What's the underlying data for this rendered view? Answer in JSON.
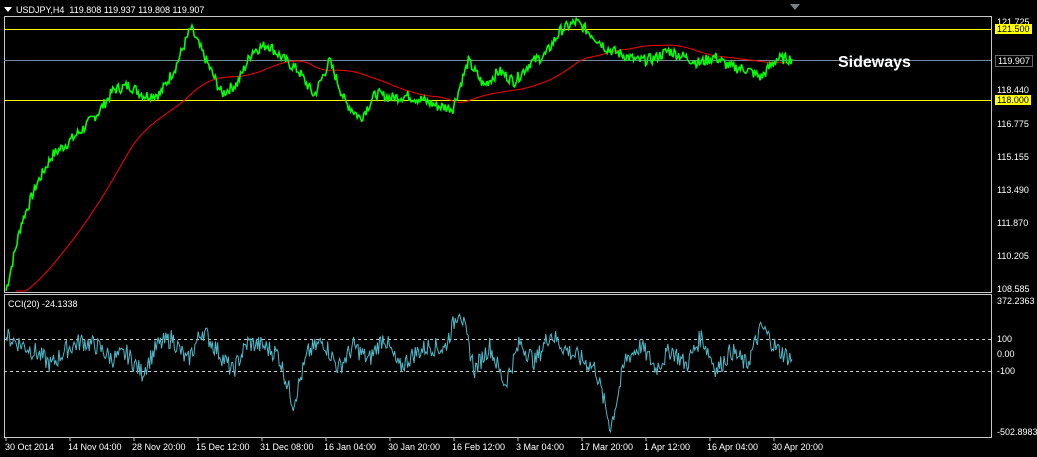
{
  "header": {
    "symbol": "USDJPY,H4",
    "ohlc": "119.808 119.937 119.808 119.907"
  },
  "annotation": "Sideways",
  "price_axis": {
    "labels": [
      "121.500",
      "119.907",
      "118.440",
      "118.000",
      "116.775",
      "115.155",
      "113.490",
      "111.870",
      "110.205",
      "108.585"
    ],
    "resistance": "121.500",
    "support": "118.000",
    "current": "119.907",
    "partial_top": "121.725"
  },
  "indicator": {
    "title": "CCI(20) -24.1338",
    "axis": [
      "372.2363",
      "100",
      "0.00",
      "-100",
      "-502.8983"
    ]
  },
  "time_axis": [
    "30 Oct 2014",
    "14 Nov 04:00",
    "28 Nov 20:00",
    "15 Dec 12:00",
    "31 Dec 08:00",
    "16 Jan 04:00",
    "30 Jan 20:00",
    "16 Feb 12:00",
    "3 Mar 04:00",
    "17 Mar 20:00",
    "1 Apr 12:00",
    "16 Apr 04:00",
    "30 Apr 20:00"
  ],
  "colors": {
    "price": "#00ff00",
    "ma": "#ff0000",
    "cci": "#4fb8c8",
    "levels": "#ffff00",
    "current_line": "#778899"
  },
  "chart_data": {
    "type": "line",
    "series": [
      {
        "name": "USDJPY,H4",
        "values": [
          108.6,
          111.9,
          113.8,
          115.2,
          115.8,
          116.5,
          117.3,
          118.4,
          118.6,
          118.1,
          118.2,
          119.5,
          121.4,
          119.8,
          118.2,
          118.7,
          120.3,
          120.6,
          119.9,
          119.3,
          118.1,
          119.8,
          117.8,
          117.0,
          118.2,
          118.0,
          118.1,
          117.9,
          117.6,
          117.5,
          119.8,
          118.6,
          119.3,
          118.8,
          119.7,
          120.1,
          121.3,
          121.7,
          121.1,
          120.4,
          120.1,
          119.8,
          119.9,
          120.3,
          120.0,
          119.7,
          120.0,
          119.5,
          119.4,
          119.0,
          119.9,
          119.9
        ]
      }
    ],
    "indicator": {
      "name": "CCI(20)",
      "last": -24.1338,
      "ylim": [
        -502.8983,
        372.2363
      ],
      "levels": [
        100,
        -100
      ],
      "values": [
        120,
        70,
        20,
        -60,
        40,
        90,
        60,
        -20,
        10,
        -110,
        60,
        110,
        -40,
        160,
        30,
        -100,
        80,
        60,
        10,
        -300,
        20,
        90,
        -80,
        60,
        -30,
        120,
        -80,
        10,
        60,
        40,
        300,
        -90,
        60,
        -180,
        80,
        -40,
        140,
        40,
        -20,
        -80,
        -450,
        -20,
        60,
        -80,
        40,
        -60,
        120,
        -90,
        30,
        -60,
        180,
        40,
        -24
      ]
    },
    "ylim": [
      108.585,
      121.9
    ]
  }
}
